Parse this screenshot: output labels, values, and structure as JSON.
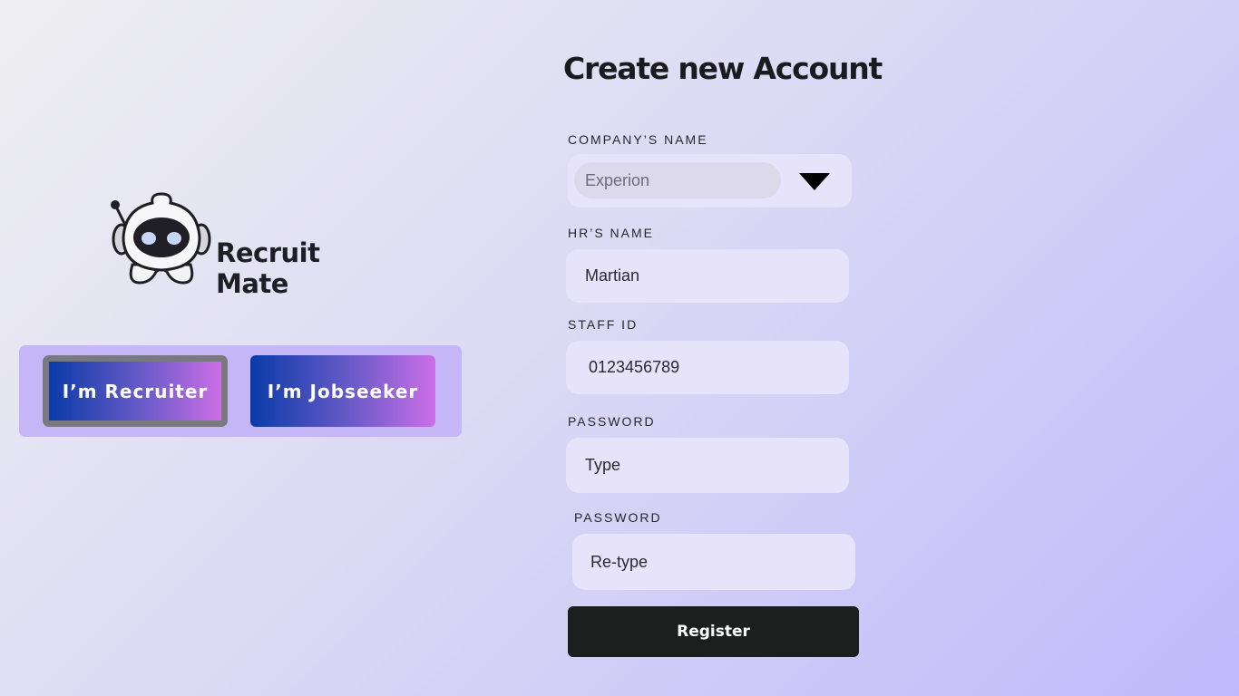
{
  "brand": {
    "name": "Recruit Mate",
    "logo_icon": "robot-mascot-icon"
  },
  "roles": {
    "recruiter_label": "I’m Recruiter",
    "jobseeker_label": "I’m Jobseeker",
    "selected": "recruiter"
  },
  "form": {
    "title": "Create new Account",
    "company": {
      "label": "COMPANY’S NAME",
      "value": "Experion",
      "dropdown_icon": "caret-down-icon"
    },
    "hr_name": {
      "label": "HR’S NAME",
      "value": "Martian"
    },
    "staff_id": {
      "label": "STAFF ID",
      "value": "0123456789"
    },
    "password": {
      "label": "PASSWORD",
      "placeholder": "Type"
    },
    "password_confirm": {
      "label": "PASSWORD",
      "placeholder": "Re-type"
    },
    "submit_label": "Register"
  },
  "colors": {
    "background_start": "#efeff1",
    "background_end": "#c1b9fb",
    "role_panel": "#c5b6f8",
    "button_gradient_start": "#0a3ba8",
    "button_gradient_end": "#cc6ee6",
    "field_bg": "#e6e3fa",
    "register_bg": "#1d1f1f"
  }
}
